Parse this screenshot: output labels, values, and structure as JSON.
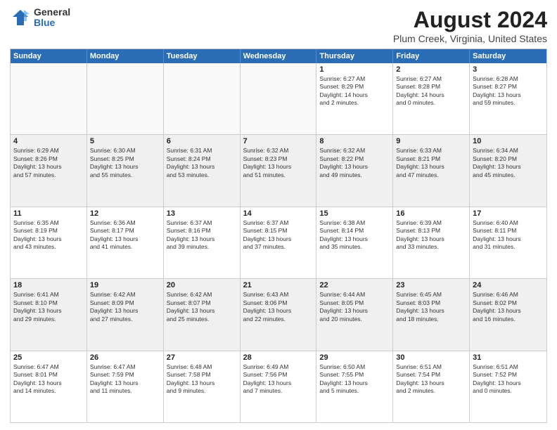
{
  "logo": {
    "general": "General",
    "blue": "Blue"
  },
  "title": "August 2024",
  "subtitle": "Plum Creek, Virginia, United States",
  "header": {
    "days": [
      "Sunday",
      "Monday",
      "Tuesday",
      "Wednesday",
      "Thursday",
      "Friday",
      "Saturday"
    ]
  },
  "weeks": [
    [
      {
        "day": "",
        "info": ""
      },
      {
        "day": "",
        "info": ""
      },
      {
        "day": "",
        "info": ""
      },
      {
        "day": "",
        "info": ""
      },
      {
        "day": "1",
        "info": "Sunrise: 6:27 AM\nSunset: 8:29 PM\nDaylight: 14 hours\nand 2 minutes."
      },
      {
        "day": "2",
        "info": "Sunrise: 6:27 AM\nSunset: 8:28 PM\nDaylight: 14 hours\nand 0 minutes."
      },
      {
        "day": "3",
        "info": "Sunrise: 6:28 AM\nSunset: 8:27 PM\nDaylight: 13 hours\nand 59 minutes."
      }
    ],
    [
      {
        "day": "4",
        "info": "Sunrise: 6:29 AM\nSunset: 8:26 PM\nDaylight: 13 hours\nand 57 minutes."
      },
      {
        "day": "5",
        "info": "Sunrise: 6:30 AM\nSunset: 8:25 PM\nDaylight: 13 hours\nand 55 minutes."
      },
      {
        "day": "6",
        "info": "Sunrise: 6:31 AM\nSunset: 8:24 PM\nDaylight: 13 hours\nand 53 minutes."
      },
      {
        "day": "7",
        "info": "Sunrise: 6:32 AM\nSunset: 8:23 PM\nDaylight: 13 hours\nand 51 minutes."
      },
      {
        "day": "8",
        "info": "Sunrise: 6:32 AM\nSunset: 8:22 PM\nDaylight: 13 hours\nand 49 minutes."
      },
      {
        "day": "9",
        "info": "Sunrise: 6:33 AM\nSunset: 8:21 PM\nDaylight: 13 hours\nand 47 minutes."
      },
      {
        "day": "10",
        "info": "Sunrise: 6:34 AM\nSunset: 8:20 PM\nDaylight: 13 hours\nand 45 minutes."
      }
    ],
    [
      {
        "day": "11",
        "info": "Sunrise: 6:35 AM\nSunset: 8:19 PM\nDaylight: 13 hours\nand 43 minutes."
      },
      {
        "day": "12",
        "info": "Sunrise: 6:36 AM\nSunset: 8:17 PM\nDaylight: 13 hours\nand 41 minutes."
      },
      {
        "day": "13",
        "info": "Sunrise: 6:37 AM\nSunset: 8:16 PM\nDaylight: 13 hours\nand 39 minutes."
      },
      {
        "day": "14",
        "info": "Sunrise: 6:37 AM\nSunset: 8:15 PM\nDaylight: 13 hours\nand 37 minutes."
      },
      {
        "day": "15",
        "info": "Sunrise: 6:38 AM\nSunset: 8:14 PM\nDaylight: 13 hours\nand 35 minutes."
      },
      {
        "day": "16",
        "info": "Sunrise: 6:39 AM\nSunset: 8:13 PM\nDaylight: 13 hours\nand 33 minutes."
      },
      {
        "day": "17",
        "info": "Sunrise: 6:40 AM\nSunset: 8:11 PM\nDaylight: 13 hours\nand 31 minutes."
      }
    ],
    [
      {
        "day": "18",
        "info": "Sunrise: 6:41 AM\nSunset: 8:10 PM\nDaylight: 13 hours\nand 29 minutes."
      },
      {
        "day": "19",
        "info": "Sunrise: 6:42 AM\nSunset: 8:09 PM\nDaylight: 13 hours\nand 27 minutes."
      },
      {
        "day": "20",
        "info": "Sunrise: 6:42 AM\nSunset: 8:07 PM\nDaylight: 13 hours\nand 25 minutes."
      },
      {
        "day": "21",
        "info": "Sunrise: 6:43 AM\nSunset: 8:06 PM\nDaylight: 13 hours\nand 22 minutes."
      },
      {
        "day": "22",
        "info": "Sunrise: 6:44 AM\nSunset: 8:05 PM\nDaylight: 13 hours\nand 20 minutes."
      },
      {
        "day": "23",
        "info": "Sunrise: 6:45 AM\nSunset: 8:03 PM\nDaylight: 13 hours\nand 18 minutes."
      },
      {
        "day": "24",
        "info": "Sunrise: 6:46 AM\nSunset: 8:02 PM\nDaylight: 13 hours\nand 16 minutes."
      }
    ],
    [
      {
        "day": "25",
        "info": "Sunrise: 6:47 AM\nSunset: 8:01 PM\nDaylight: 13 hours\nand 14 minutes."
      },
      {
        "day": "26",
        "info": "Sunrise: 6:47 AM\nSunset: 7:59 PM\nDaylight: 13 hours\nand 11 minutes."
      },
      {
        "day": "27",
        "info": "Sunrise: 6:48 AM\nSunset: 7:58 PM\nDaylight: 13 hours\nand 9 minutes."
      },
      {
        "day": "28",
        "info": "Sunrise: 6:49 AM\nSunset: 7:56 PM\nDaylight: 13 hours\nand 7 minutes."
      },
      {
        "day": "29",
        "info": "Sunrise: 6:50 AM\nSunset: 7:55 PM\nDaylight: 13 hours\nand 5 minutes."
      },
      {
        "day": "30",
        "info": "Sunrise: 6:51 AM\nSunset: 7:54 PM\nDaylight: 13 hours\nand 2 minutes."
      },
      {
        "day": "31",
        "info": "Sunrise: 6:51 AM\nSunset: 7:52 PM\nDaylight: 13 hours\nand 0 minutes."
      }
    ]
  ]
}
